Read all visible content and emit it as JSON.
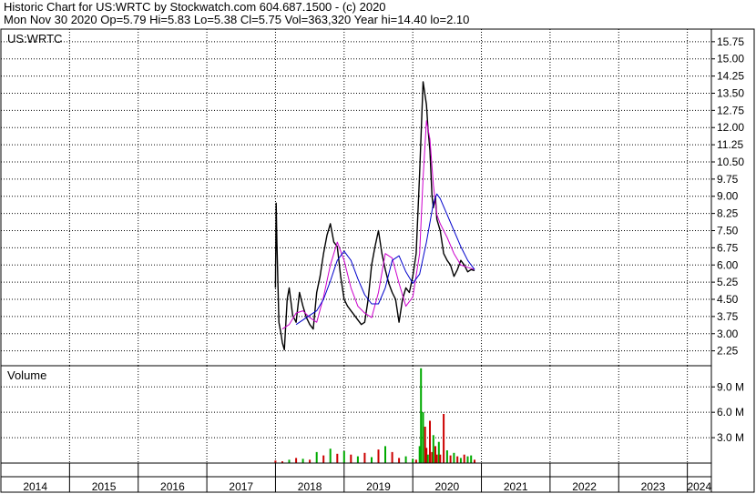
{
  "header": {
    "line1": "Historic Chart for US:WRTC by Stockwatch.com 604.687.1500 - (c) 2020",
    "line2": "Mon Nov 30 2020  Op=5.79  Hi=5.83  Lo=5.38  Cl=5.75  Vol=363,320  Year hi=14.40  lo=2.10"
  },
  "chart_data": [
    {
      "type": "line",
      "symbol_label": "US:WRTC",
      "y_ticks": [
        "15.75",
        "15.00",
        "14.25",
        "13.50",
        "12.75",
        "12.00",
        "11.25",
        "10.50",
        "9.75",
        "9.00",
        "8.25",
        "7.50",
        "6.75",
        "6.00",
        "5.25",
        "4.50",
        "3.75",
        "3.00",
        "2.25"
      ],
      "ylim": [
        1.6,
        16.3
      ],
      "x_ticks": [
        "2014",
        "2015",
        "2016",
        "2017",
        "2018",
        "2019",
        "2020",
        "2021",
        "2022",
        "2023",
        "2024"
      ],
      "xlim": [
        2014.0,
        2024.35
      ],
      "grid": true,
      "series": [
        {
          "color": "#000000",
          "x": [
            2018.0,
            2018.01,
            2018.02,
            2018.05,
            2018.08,
            2018.1,
            2018.13,
            2018.17,
            2018.2,
            2018.25,
            2018.3,
            2018.35,
            2018.4,
            2018.45,
            2018.5,
            2018.55,
            2018.6,
            2018.65,
            2018.7,
            2018.75,
            2018.8,
            2018.85,
            2018.9,
            2018.95,
            2019.0,
            2019.05,
            2019.1,
            2019.15,
            2019.2,
            2019.25,
            2019.3,
            2019.35,
            2019.4,
            2019.45,
            2019.5,
            2019.55,
            2019.6,
            2019.65,
            2019.7,
            2019.75,
            2019.8,
            2019.85,
            2019.9,
            2019.95,
            2020.0,
            2020.05,
            2020.1,
            2020.15,
            2020.2,
            2020.22,
            2020.25,
            2020.28,
            2020.3,
            2020.33,
            2020.35,
            2020.4,
            2020.45,
            2020.5,
            2020.55,
            2020.6,
            2020.65,
            2020.7,
            2020.75,
            2020.8,
            2020.85,
            2020.9
          ],
          "y": [
            5.0,
            8.7,
            7.0,
            3.5,
            3.0,
            2.6,
            2.3,
            4.5,
            5.0,
            3.8,
            3.5,
            4.8,
            4.2,
            3.7,
            3.4,
            3.2,
            4.8,
            5.5,
            6.5,
            7.3,
            7.8,
            7.0,
            6.8,
            5.5,
            4.5,
            4.2,
            4.0,
            3.8,
            3.6,
            3.4,
            3.5,
            4.5,
            6.0,
            6.8,
            7.5,
            6.5,
            5.8,
            5.2,
            4.8,
            4.5,
            3.5,
            4.5,
            5.0,
            4.8,
            5.5,
            6.5,
            10.0,
            14.0,
            13.0,
            12.0,
            11.0,
            9.0,
            8.5,
            9.0,
            8.0,
            7.5,
            6.5,
            6.2,
            6.0,
            5.5,
            5.8,
            6.2,
            6.0,
            5.7,
            5.8,
            5.75
          ],
          "name": ""
        },
        {
          "color": "#cc00cc",
          "x": [
            2018.1,
            2018.2,
            2018.3,
            2018.4,
            2018.5,
            2018.6,
            2018.7,
            2018.8,
            2018.9,
            2019.0,
            2019.1,
            2019.2,
            2019.3,
            2019.4,
            2019.5,
            2019.6,
            2019.7,
            2019.8,
            2019.9,
            2020.0,
            2020.1,
            2020.15,
            2020.2,
            2020.25,
            2020.3,
            2020.35,
            2020.4,
            2020.5,
            2020.6,
            2020.7,
            2020.8,
            2020.9
          ],
          "y": [
            3.2,
            3.4,
            3.9,
            4.0,
            3.7,
            3.5,
            4.6,
            6.0,
            7.0,
            6.2,
            5.0,
            4.2,
            3.9,
            3.7,
            4.8,
            6.5,
            6.3,
            5.2,
            4.2,
            4.6,
            6.5,
            9.8,
            12.3,
            11.5,
            9.5,
            8.2,
            7.8,
            7.2,
            6.5,
            6.0,
            5.9,
            5.8
          ],
          "name": ""
        },
        {
          "color": "#0000cc",
          "x": [
            2018.3,
            2018.4,
            2018.5,
            2018.6,
            2018.7,
            2018.8,
            2018.9,
            2019.0,
            2019.1,
            2019.2,
            2019.3,
            2019.4,
            2019.5,
            2019.6,
            2019.7,
            2019.8,
            2019.9,
            2020.0,
            2020.1,
            2020.2,
            2020.3,
            2020.35,
            2020.4,
            2020.5,
            2020.6,
            2020.7,
            2020.8,
            2020.9
          ],
          "y": [
            3.4,
            3.6,
            3.8,
            4.0,
            4.5,
            5.3,
            6.2,
            6.6,
            6.2,
            5.4,
            4.7,
            4.3,
            4.3,
            5.0,
            6.2,
            6.4,
            5.7,
            5.2,
            5.6,
            7.0,
            8.7,
            9.1,
            8.9,
            8.2,
            7.5,
            6.8,
            6.2,
            5.8
          ],
          "name": ""
        }
      ]
    },
    {
      "type": "bar",
      "label": "Volume",
      "y_ticks": [
        "9.0 M",
        "6.0 M",
        "3.0 M"
      ],
      "ylim": [
        0,
        11.5
      ],
      "grid": true,
      "x": [
        2018.0,
        2018.1,
        2018.2,
        2018.3,
        2018.4,
        2018.5,
        2018.6,
        2018.7,
        2018.8,
        2018.9,
        2019.0,
        2019.1,
        2019.2,
        2019.3,
        2019.4,
        2019.5,
        2019.6,
        2019.7,
        2019.8,
        2019.9,
        2020.0,
        2020.05,
        2020.1,
        2020.12,
        2020.15,
        2020.18,
        2020.2,
        2020.22,
        2020.25,
        2020.28,
        2020.3,
        2020.33,
        2020.35,
        2020.38,
        2020.4,
        2020.45,
        2020.5,
        2020.55,
        2020.6,
        2020.65,
        2020.7,
        2020.75,
        2020.8,
        2020.85,
        2020.9
      ],
      "values": [
        0.3,
        0.2,
        0.4,
        0.6,
        0.5,
        0.4,
        1.3,
        0.9,
        1.7,
        1.1,
        1.4,
        1.0,
        0.8,
        1.2,
        0.7,
        1.6,
        2.0,
        1.3,
        0.6,
        0.8,
        0.5,
        0.4,
        2.0,
        11.2,
        6.0,
        4.3,
        1.8,
        1.0,
        5.0,
        1.3,
        3.3,
        2.0,
        1.0,
        2.5,
        1.0,
        5.8,
        1.5,
        0.9,
        1.2,
        0.8,
        0.6,
        1.0,
        0.8,
        0.9,
        0.4
      ],
      "colors": [
        "#cc0000",
        "#cc0000",
        "#00aa00",
        "#cc0000",
        "#00aa00",
        "#cc0000",
        "#00aa00",
        "#cc0000",
        "#00aa00",
        "#cc0000",
        "#00aa00",
        "#cc0000",
        "#00aa00",
        "#cc0000",
        "#00aa00",
        "#cc0000",
        "#00aa00",
        "#cc0000",
        "#cc0000",
        "#00aa00",
        "#00aa00",
        "#cc0000",
        "#00aa00",
        "#00aa00",
        "#00aa00",
        "#cc0000",
        "#cc0000",
        "#00aa00",
        "#cc0000",
        "#cc0000",
        "#00aa00",
        "#cc0000",
        "#cc0000",
        "#00aa00",
        "#cc0000",
        "#cc0000",
        "#00aa00",
        "#cc0000",
        "#00aa00",
        "#cc0000",
        "#00aa00",
        "#cc0000",
        "#00aa00",
        "#00aa00",
        "#cc0000"
      ]
    }
  ]
}
